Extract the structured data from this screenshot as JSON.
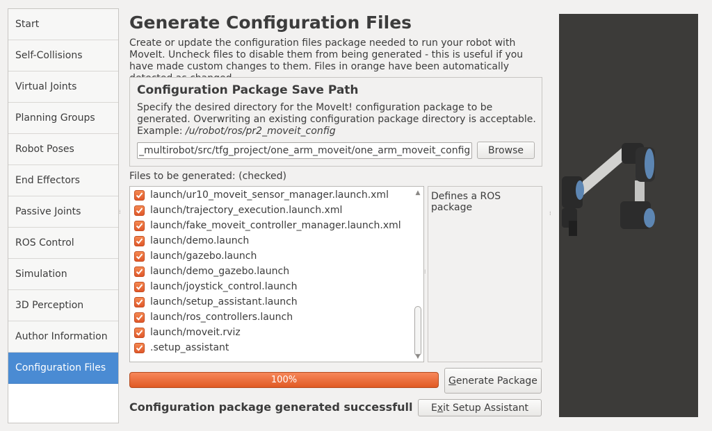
{
  "sidebar": {
    "items": [
      {
        "label": "Start"
      },
      {
        "label": "Self-Collisions"
      },
      {
        "label": "Virtual Joints"
      },
      {
        "label": "Planning Groups"
      },
      {
        "label": "Robot Poses"
      },
      {
        "label": "End Effectors"
      },
      {
        "label": "Passive Joints"
      },
      {
        "label": "ROS Control"
      },
      {
        "label": "Simulation"
      },
      {
        "label": "3D Perception"
      },
      {
        "label": "Author Information"
      },
      {
        "label": "Configuration Files"
      }
    ],
    "active_index": 11
  },
  "main": {
    "title": "Generate Configuration Files",
    "description": "Create or update the configuration files package needed to run your robot with MoveIt. Uncheck files to disable them from being generated - this is useful if you have made custom changes to them. Files in orange have been automatically detected as changed."
  },
  "save_path": {
    "title": "Configuration Package Save Path",
    "description": "Specify the desired directory for the MoveIt! configuration package to be generated. Overwriting an existing configuration package directory is acceptable. Example: ",
    "example": "/u/robot/ros/pr2_moveit_config",
    "value": "_multirobot/src/tfg_project/one_arm_moveit/one_arm_moveit_config",
    "browse_label": "Browse"
  },
  "files": {
    "label": "Files to be generated: (checked)",
    "items": [
      {
        "name": "launch/ur10_moveit_sensor_manager.launch.xml",
        "checked": true
      },
      {
        "name": "launch/trajectory_execution.launch.xml",
        "checked": true
      },
      {
        "name": "launch/fake_moveit_controller_manager.launch.xml",
        "checked": true
      },
      {
        "name": "launch/demo.launch",
        "checked": true
      },
      {
        "name": "launch/gazebo.launch",
        "checked": true
      },
      {
        "name": "launch/demo_gazebo.launch",
        "checked": true
      },
      {
        "name": "launch/joystick_control.launch",
        "checked": true
      },
      {
        "name": "launch/setup_assistant.launch",
        "checked": true
      },
      {
        "name": "launch/ros_controllers.launch",
        "checked": true
      },
      {
        "name": "launch/moveit.rviz",
        "checked": true
      },
      {
        "name": ".setup_assistant",
        "checked": true
      }
    ],
    "description": "Defines a ROS package"
  },
  "progress": {
    "value": 1.0,
    "label": "100%"
  },
  "actions": {
    "generate_prefix": "",
    "generate_mnemonic": "G",
    "generate_rest": "enerate Package",
    "exit_prefix": "E",
    "exit_mnemonic": "x",
    "exit_rest": "it Setup Assistant"
  },
  "status": "Configuration package generated successfull",
  "colors": {
    "accent": "#4a8bd3",
    "progress": "#e8652f",
    "viewer_bg": "#3c3b39"
  },
  "icons": {
    "check": "check-icon",
    "scroll_up": "chevron-up-icon",
    "scroll_down": "chevron-down-icon"
  }
}
